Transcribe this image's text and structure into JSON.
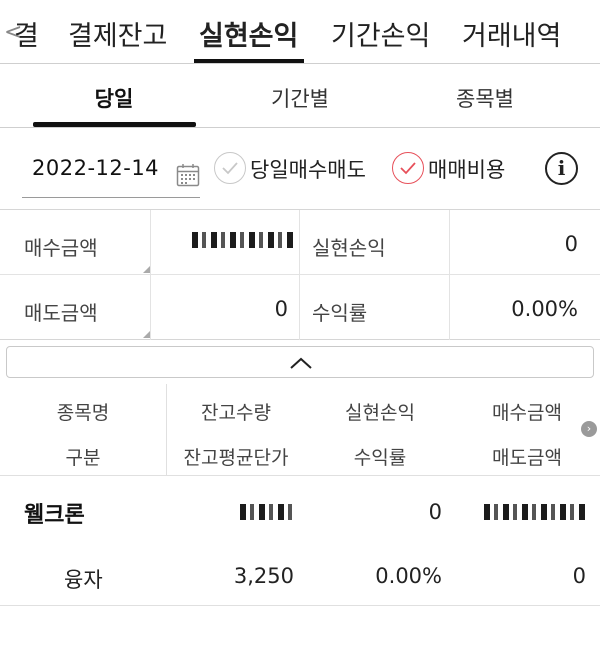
{
  "top_tabs": {
    "back_glyph": "<",
    "partial_tab": "결",
    "tabs": [
      {
        "label": "결제잔고",
        "active": false
      },
      {
        "label": "실현손익",
        "active": true
      },
      {
        "label": "기간손익",
        "active": false
      },
      {
        "label": "거래내역",
        "active": false
      }
    ]
  },
  "sub_tabs": [
    {
      "label": "당일",
      "active": true
    },
    {
      "label": "기간별",
      "active": false
    },
    {
      "label": "종목별",
      "active": false
    }
  ],
  "filter": {
    "date": "2022-12-14",
    "checkbox_today_buy_sell": {
      "label": "당일매수매도",
      "checked": false
    },
    "checkbox_trade_cost": {
      "label": "매매비용",
      "checked": true
    },
    "info_glyph": "i"
  },
  "summary": {
    "buy_amount_label": "매수금액",
    "buy_amount_value": "",
    "realized_pnl_label": "실현손익",
    "realized_pnl_value": "0",
    "sell_amount_label": "매도금액",
    "sell_amount_value": "0",
    "return_rate_label": "수익률",
    "return_rate_value": "0.00%"
  },
  "table": {
    "headers_row1": [
      "종목명",
      "잔고수량",
      "실현손익",
      "매수금액"
    ],
    "headers_row2": [
      "구분",
      "잔고평균단가",
      "수익률",
      "매도금액"
    ],
    "rows": [
      {
        "name": "웰크론",
        "balance_qty": "",
        "realized_pnl": "0",
        "buy_amount": "",
        "type": "융자",
        "avg_price": "3,250",
        "return_rate": "0.00%",
        "sell_amount": "0"
      }
    ]
  },
  "colors": {
    "accent_red": "#e7505a",
    "underline": "#111111"
  }
}
